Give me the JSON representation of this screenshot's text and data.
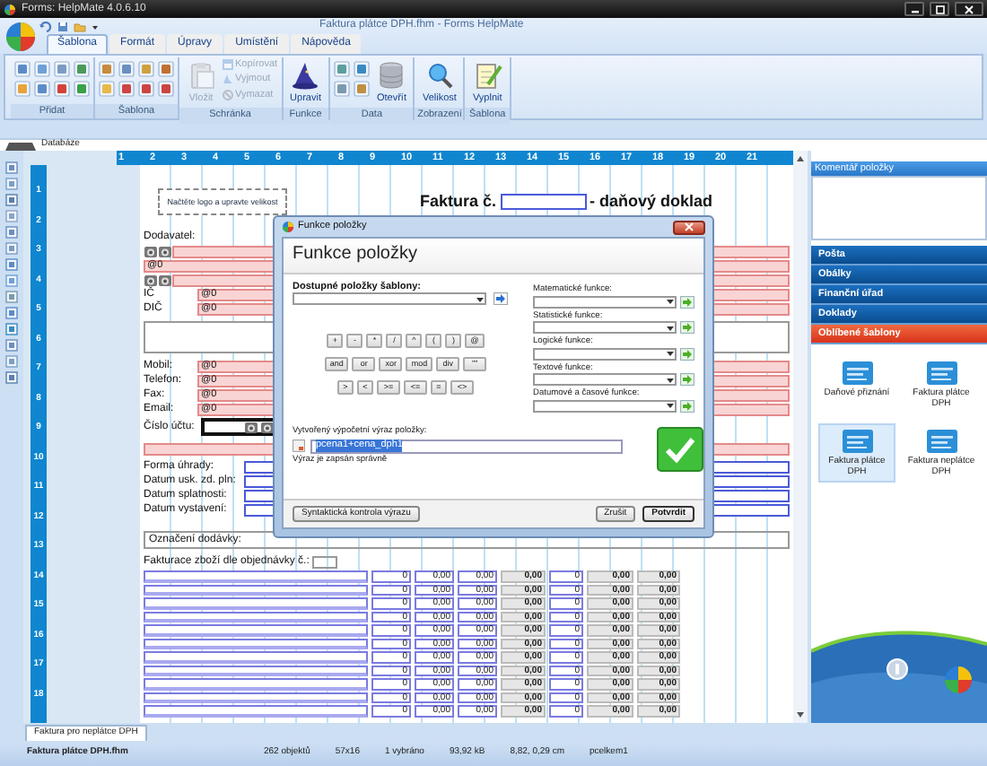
{
  "window": {
    "app_title": "Forms: HelpMate 4.0.6.10",
    "document_title": "Faktura plátce DPH.fhm - Forms HelpMate"
  },
  "ribbon_tabs": [
    {
      "label": "Šablona",
      "selected": true
    },
    {
      "label": "Formát",
      "selected": false
    },
    {
      "label": "Úpravy",
      "selected": false
    },
    {
      "label": "Umístění",
      "selected": false
    },
    {
      "label": "Nápověda",
      "selected": false
    }
  ],
  "ribbon_groups": [
    {
      "label": "Přidat",
      "icon_grid": true
    },
    {
      "label": "Šablona",
      "icon_grid": true
    },
    {
      "label": "Schránka",
      "buttons": [
        {
          "label": "Vložit",
          "kind": "large",
          "disabled": true
        },
        {
          "label": "Kopírovat",
          "kind": "small",
          "disabled": true
        },
        {
          "label": "Vyjmout",
          "kind": "small",
          "disabled": true
        },
        {
          "label": "Vymazat",
          "kind": "small",
          "disabled": true
        }
      ]
    },
    {
      "label": "Funkce",
      "buttons": [
        {
          "label": "Upravit",
          "kind": "large",
          "disabled": false
        }
      ]
    },
    {
      "label": "Data",
      "icon_grid": true,
      "buttons": [
        {
          "label": "Otevřít",
          "kind": "large",
          "disabled": false
        }
      ]
    },
    {
      "label": "Zobrazení",
      "buttons": [
        {
          "label": "Velikost",
          "kind": "large",
          "disabled": false
        }
      ]
    },
    {
      "label": "Šablona",
      "buttons": [
        {
          "label": "Vyplnit",
          "kind": "large",
          "disabled": false
        }
      ]
    }
  ],
  "view_tabs": [
    {
      "label": "Databáze",
      "selected": false
    }
  ],
  "ruler": {
    "x_labels": [
      "1",
      "2",
      "3",
      "4",
      "5",
      "6",
      "7",
      "8",
      "9",
      "10",
      "11",
      "12",
      "13",
      "14",
      "15",
      "16",
      "17",
      "18",
      "19",
      "20",
      "21"
    ],
    "y_labels": [
      "1",
      "2",
      "3",
      "4",
      "5",
      "6",
      "7",
      "8",
      "9",
      "10",
      "11",
      "12",
      "13",
      "14",
      "15",
      "16",
      "17",
      "18"
    ]
  },
  "document": {
    "logo_placeholder": "Načtěte logo a upravte velikost",
    "title": "Faktura č.",
    "subtitle": "- daňový doklad",
    "lines": [
      {
        "kind": "label",
        "label": "Dodavatel:"
      },
      {
        "kind": "images"
      },
      {
        "kind": "field",
        "value": "@0"
      },
      {
        "kind": "images"
      },
      {
        "kind": "field",
        "label": "IČ",
        "value": "@0"
      },
      {
        "kind": "field",
        "label": "DIČ",
        "value": "@0"
      },
      {
        "kind": "blank"
      },
      {
        "kind": "field",
        "label": "Mobil:",
        "value": "@0"
      },
      {
        "kind": "field",
        "label": "Telefon:",
        "value": "@0"
      },
      {
        "kind": "field",
        "label": "Fax:",
        "value": "@0"
      },
      {
        "kind": "field",
        "label": "Email:",
        "value": "@0"
      },
      {
        "kind": "account",
        "label": "Číslo účtu:"
      },
      {
        "kind": "empty_field"
      },
      {
        "kind": "input",
        "label": "Forma úhrady:"
      },
      {
        "kind": "input",
        "label": "Datum usk. zd. pln:"
      },
      {
        "kind": "input",
        "label": "Datum splatnosti:"
      },
      {
        "kind": "input",
        "label": "Datum vystavení:"
      },
      {
        "kind": "boxed",
        "label": "Označení dodávky:"
      },
      {
        "kind": "order",
        "label": "Fakturace zboží dle objednávky č.:"
      }
    ],
    "rows": [
      {
        "cells": [
          "0",
          "0,00",
          "0,00",
          "0,00",
          "0",
          "0,00",
          "0,00"
        ]
      },
      {
        "cells": [
          "0",
          "0,00",
          "0,00",
          "0,00",
          "0",
          "0,00",
          "0,00"
        ]
      },
      {
        "cells": [
          "0",
          "0,00",
          "0,00",
          "0,00",
          "0",
          "0,00",
          "0,00"
        ]
      },
      {
        "cells": [
          "0",
          "0,00",
          "0,00",
          "0,00",
          "0",
          "0,00",
          "0,00"
        ]
      },
      {
        "cells": [
          "0",
          "0,00",
          "0,00",
          "0,00",
          "0",
          "0,00",
          "0,00"
        ]
      },
      {
        "cells": [
          "0",
          "0,00",
          "0,00",
          "0,00",
          "0",
          "0,00",
          "0,00"
        ]
      },
      {
        "cells": [
          "0",
          "0,00",
          "0,00",
          "0,00",
          "0",
          "0,00",
          "0,00"
        ]
      },
      {
        "cells": [
          "0",
          "0,00",
          "0,00",
          "0,00",
          "0",
          "0,00",
          "0,00"
        ]
      },
      {
        "cells": [
          "0",
          "0,00",
          "0,00",
          "0,00",
          "0",
          "0,00",
          "0,00"
        ]
      },
      {
        "cells": [
          "0",
          "0,00",
          "0,00",
          "0,00",
          "0",
          "0,00",
          "0,00"
        ]
      },
      {
        "cells": [
          "0",
          "0,00",
          "0,00",
          "0,00",
          "0",
          "0,00",
          "0,00"
        ]
      }
    ]
  },
  "dialog": {
    "window_title": "Funkce položky",
    "heading": "Funkce položky",
    "fields_label": "Dostupné položky šablony:",
    "operators": [
      [
        "+",
        "-",
        "*",
        "/",
        "^",
        "(",
        ")",
        "@"
      ],
      [
        "and",
        "or",
        "xor",
        "mod",
        "div",
        "\"\""
      ],
      [
        ">",
        "<",
        ">=",
        "<=",
        "=",
        "<>"
      ]
    ],
    "function_groups": [
      "Matematické funkce:",
      "Statistické funkce:",
      "Logické funkce:",
      "Textové funkce:",
      "Datumové a časové funkce:"
    ],
    "expression_label": "Vytvořený výpočetní výraz položky:",
    "expression": "pcena1+cena_dph1",
    "expression_selected": true,
    "valid": true,
    "message": "Výraz je zapsán správně",
    "check_button": "Syntaktická kontrola výrazu",
    "cancel_button": "Zrušit",
    "confirm_button": "Potvrdit"
  },
  "side_panel": {
    "comment_title": "Komentář položky",
    "categories": [
      {
        "label": "Pošta",
        "selected": false
      },
      {
        "label": "Obálky",
        "selected": false
      },
      {
        "label": "Finanční úřad",
        "selected": false
      },
      {
        "label": "Doklady",
        "selected": false
      },
      {
        "label": "Oblíbené šablony",
        "selected": true
      }
    ],
    "templates": [
      {
        "label": "Daňové přiznání",
        "selected": false
      },
      {
        "label": "Faktura plátce DPH",
        "selected": false
      },
      {
        "label": "Faktura plátce DPH",
        "selected": true
      },
      {
        "label": "Faktura neplátce DPH",
        "selected": false
      }
    ]
  },
  "sheet_tabs": [
    {
      "label": "Faktura pro neplátce DPH",
      "selected": true
    }
  ],
  "status_bar": [
    "Faktura plátce DPH.fhm",
    "262 objektů",
    "57x16",
    "1 vybráno",
    "93,92 kB",
    "8,82, 0,29 cm",
    "pcelkem1"
  ]
}
